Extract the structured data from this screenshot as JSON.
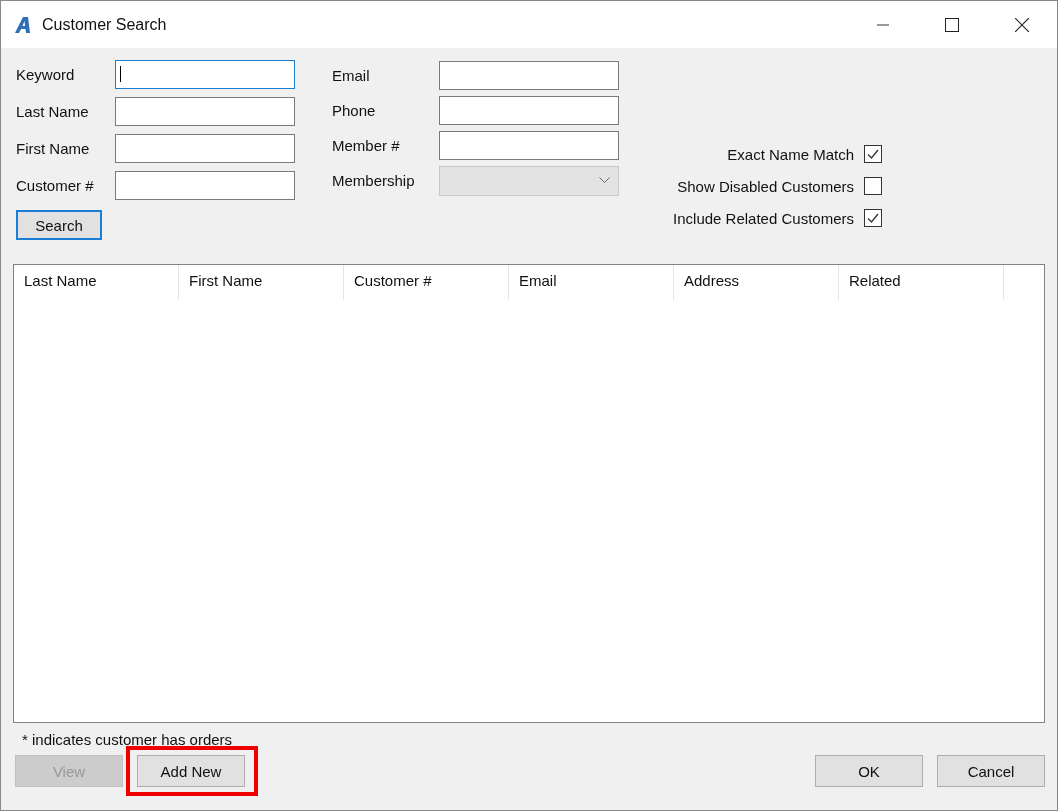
{
  "window": {
    "title": "Customer Search"
  },
  "left_fields": [
    {
      "label": "Keyword",
      "focused": true
    },
    {
      "label": "Last Name",
      "focused": false
    },
    {
      "label": "First Name",
      "focused": false
    },
    {
      "label": "Customer #",
      "focused": false
    }
  ],
  "middle_fields": [
    {
      "label": "Email",
      "kind": "text",
      "disabled": false
    },
    {
      "label": "Phone",
      "kind": "text",
      "disabled": false
    },
    {
      "label": "Member #",
      "kind": "text",
      "disabled": false
    },
    {
      "label": "Membership",
      "kind": "dropdown",
      "disabled": true
    }
  ],
  "options": [
    {
      "label": "Exact Name Match",
      "checked": true
    },
    {
      "label": "Show Disabled Customers",
      "checked": false
    },
    {
      "label": "Include Related Customers",
      "checked": true
    }
  ],
  "search_button": {
    "label": "Search"
  },
  "table": {
    "columns": [
      "Last Name",
      "First Name",
      "Customer #",
      "Email",
      "Address",
      "Related"
    ]
  },
  "note": "* indicates customer has orders",
  "left_buttons": [
    {
      "label": "View",
      "disabled": true,
      "highlighted": false
    },
    {
      "label": "Add New",
      "disabled": false,
      "highlighted": true
    }
  ],
  "right_buttons": [
    {
      "label": "OK"
    },
    {
      "label": "Cancel"
    }
  ]
}
